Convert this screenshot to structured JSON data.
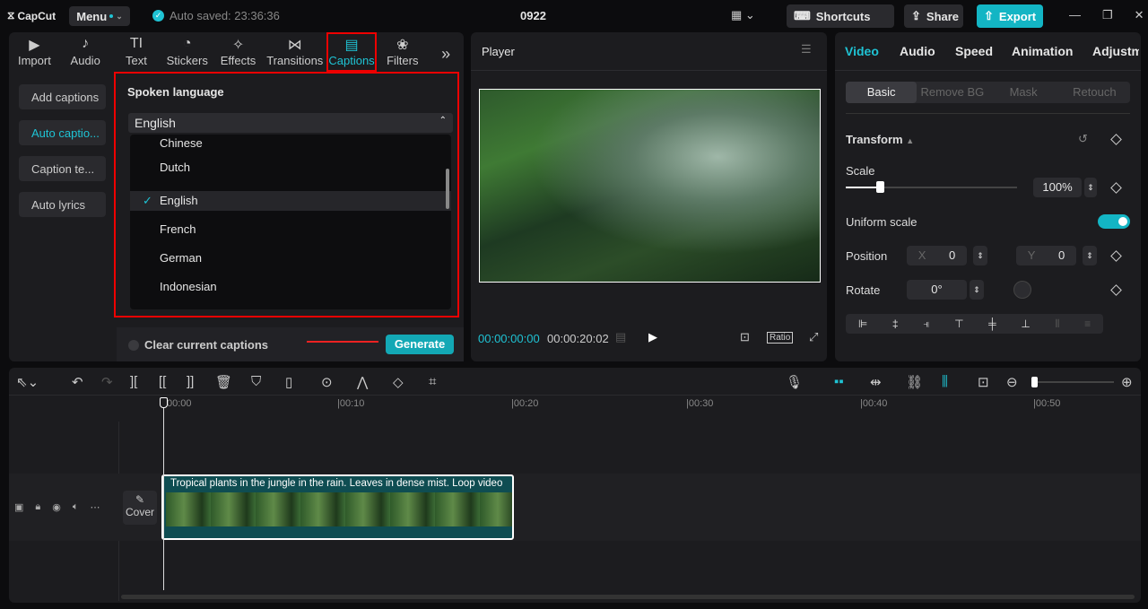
{
  "app": {
    "logo": "CapCut",
    "menu": "Menu",
    "autosave": "Auto saved: 23:36:36",
    "title": "0922",
    "shortcuts": "Shortcuts",
    "share": "Share",
    "export": "Export"
  },
  "tabs": [
    {
      "label": "Import",
      "icon": "▶"
    },
    {
      "label": "Audio",
      "icon": "♪"
    },
    {
      "label": "Text",
      "icon": "TI"
    },
    {
      "label": "Stickers",
      "icon": "◔"
    },
    {
      "label": "Effects",
      "icon": "✧"
    },
    {
      "label": "Transitions",
      "icon": "⋈"
    },
    {
      "label": "Captions",
      "icon": "▤"
    },
    {
      "label": "Filters",
      "icon": "❀"
    }
  ],
  "side": [
    "Add captions",
    "Auto captio...",
    "Caption te...",
    "Auto lyrics"
  ],
  "captions": {
    "heading": "Spoken language",
    "selected": "English",
    "options": [
      "Chinese",
      "Dutch",
      "English",
      "French",
      "German",
      "Indonesian"
    ],
    "clear": "Clear current captions",
    "generate": "Generate"
  },
  "player": {
    "title": "Player",
    "time": "00:00:00:00",
    "duration": "00:00:20:02",
    "ratio": "Ratio"
  },
  "right": {
    "tabs": [
      "Video",
      "Audio",
      "Speed",
      "Animation",
      "Adjustme"
    ],
    "subtabs": [
      "Basic",
      "Remove BG",
      "Mask",
      "Retouch"
    ],
    "transform": "Transform",
    "scale": "Scale",
    "scale_val": "100%",
    "scale_fraction": 0.2,
    "uniform": "Uniform scale",
    "uniform_on": true,
    "position": "Position",
    "x_label": "X",
    "x": "0",
    "y_label": "Y",
    "y": "0",
    "rotate": "Rotate",
    "rotate_val": "0°"
  },
  "timeline": {
    "ticks": [
      "00:00",
      "|00:10",
      "|00:20",
      "|00:30",
      "|00:40",
      "|00:50"
    ],
    "clip": "Tropical plants in the jungle in the rain. Leaves in dense mist. Loop video",
    "cover": "Cover"
  },
  "colors": {
    "accent": "#1fc3d4",
    "highlight": "#ee0000"
  }
}
